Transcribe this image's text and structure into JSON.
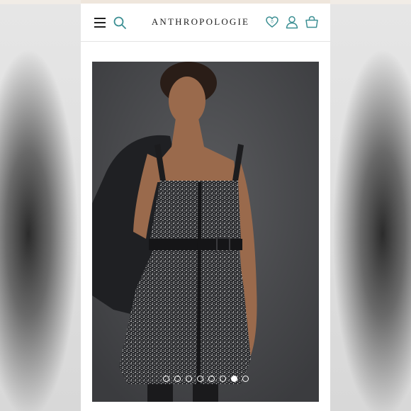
{
  "header": {
    "brand": "ANTHROPOLOGIE",
    "icons": [
      "menu-icon",
      "search-icon",
      "heart-icon",
      "user-icon",
      "bag-icon"
    ]
  },
  "gallery": {
    "total_images": 8,
    "active_index": 6
  },
  "colors": {
    "accent": "#3c8f93",
    "text": "#1f1f1f",
    "top_strip": "#efe6dc"
  }
}
